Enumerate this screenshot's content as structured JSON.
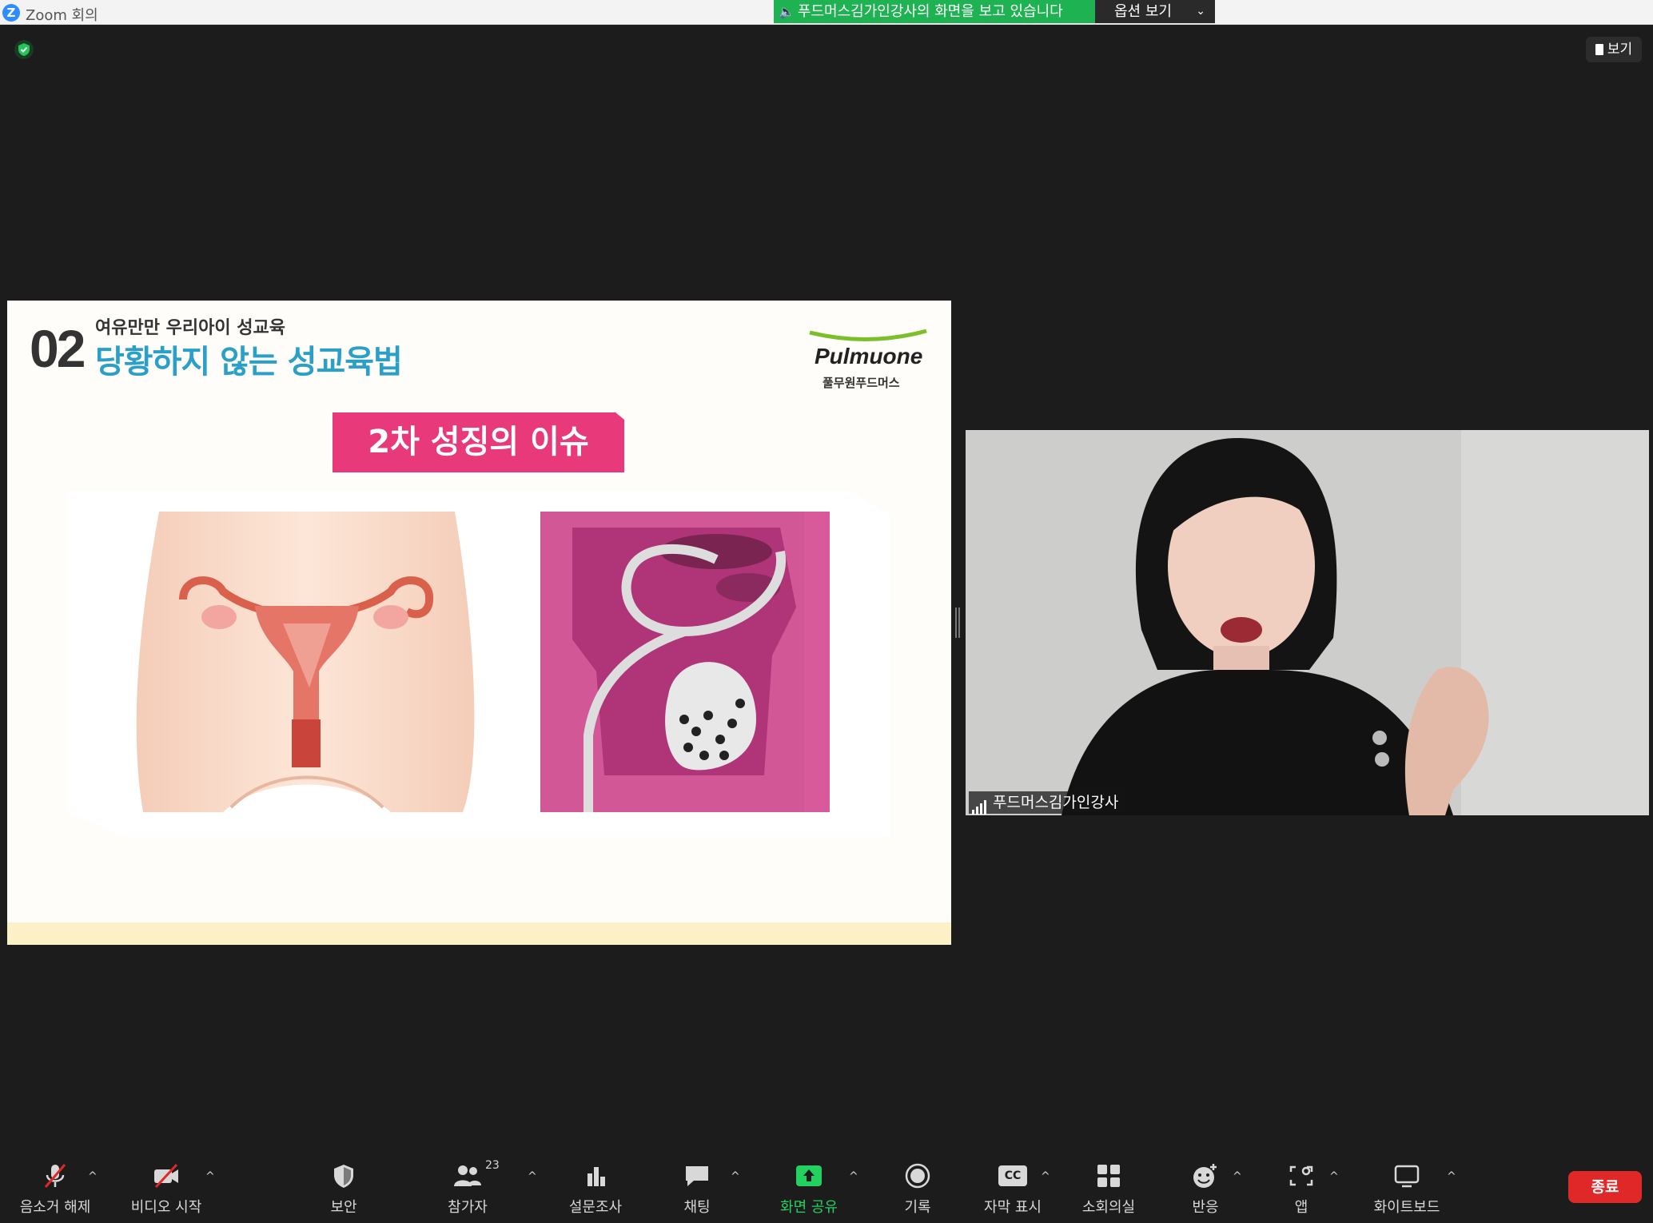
{
  "window": {
    "app_title": "Zoom 회의",
    "logo_letter": "Z"
  },
  "share_banner": {
    "text": "푸드머스김가인강사의 화면을 보고 있습니다",
    "options_label": "옵션 보기"
  },
  "view_button": {
    "label": "보기"
  },
  "slide": {
    "number": "02",
    "subtitle": "여유만만 우리아이 성교육",
    "title": "당황하지 않는 성교육법",
    "brand_name": "Pulmuone",
    "brand_sub": "풀무원푸드머스",
    "label": "2차 성징의 이슈"
  },
  "participant": {
    "name": "푸드머스김가인강사"
  },
  "toolbar": {
    "unmute": "음소거 해제",
    "start_video": "비디오 시작",
    "security": "보안",
    "participants": "참가자",
    "participants_count": "23",
    "polls": "설문조사",
    "chat": "채팅",
    "share_screen": "화면 공유",
    "record": "기록",
    "captions": "자막 표시",
    "captions_icon_text": "CC",
    "breakout": "소회의실",
    "reactions": "반응",
    "apps": "앱",
    "whiteboard": "화이트보드",
    "end": "종료",
    "caret": "^"
  },
  "colors": {
    "share_green": "#1fb253",
    "accent_pink": "#e8397a",
    "title_blue": "#2aa0c8",
    "end_red": "#e02828",
    "toolbar_green": "#23d160"
  }
}
